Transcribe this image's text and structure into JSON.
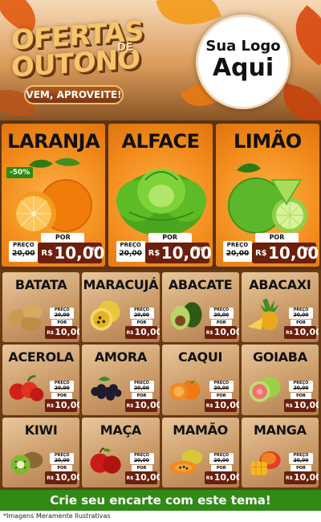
{
  "header": {
    "title_line1": "OFERTAS",
    "title_de": "DE",
    "title_line2": "OUTONO",
    "slogan": "VEM, APROVEITE!",
    "logo_line1": "Sua Logo",
    "logo_line2": "Aqui"
  },
  "featured": [
    {
      "name": "LARANJA",
      "discount": "-50%",
      "por_label": "POR",
      "old_label": "PREÇO",
      "old_price": "20,00",
      "currency": "R$",
      "price": "10,00",
      "unit": "KG",
      "image": "orange-image"
    },
    {
      "name": "ALFACE",
      "por_label": "POR",
      "old_label": "PREÇO",
      "old_price": "20,00",
      "currency": "R$",
      "price": "10,00",
      "unit": "UNID",
      "image": "lettuce-image"
    },
    {
      "name": "LIMÃO",
      "por_label": "POR",
      "old_label": "PREÇO",
      "old_price": "20,00",
      "currency": "R$",
      "price": "10,00",
      "unit": "KG",
      "image": "lime-image"
    }
  ],
  "products": [
    {
      "name": "BATATA",
      "old_label": "PREÇO",
      "old_price": "20,00",
      "por_label": "POR",
      "currency": "R$",
      "price": "10,00",
      "image": "potato-image"
    },
    {
      "name": "MARACUJÁ",
      "old_label": "PREÇO",
      "old_price": "20,00",
      "por_label": "POR",
      "currency": "R$",
      "price": "10,00",
      "image": "passionfruit-image"
    },
    {
      "name": "ABACATE",
      "old_label": "PREÇO",
      "old_price": "20,00",
      "por_label": "POR",
      "currency": "R$",
      "price": "10,00",
      "image": "avocado-image"
    },
    {
      "name": "ABACAXI",
      "old_label": "PREÇO",
      "old_price": "20,00",
      "por_label": "POR",
      "currency": "R$",
      "price": "10,00",
      "image": "pineapple-image"
    },
    {
      "name": "ACEROLA",
      "old_label": "PREÇO",
      "old_price": "20,00",
      "por_label": "POR",
      "currency": "R$",
      "price": "10,00",
      "image": "acerola-image"
    },
    {
      "name": "AMORA",
      "old_label": "PREÇO",
      "old_price": "20,00",
      "por_label": "POR",
      "currency": "R$",
      "price": "10,00",
      "image": "blackberry-image"
    },
    {
      "name": "CAQUI",
      "old_label": "PREÇO",
      "old_price": "20,00",
      "por_label": "POR",
      "currency": "R$",
      "price": "10,00",
      "image": "persimmon-image"
    },
    {
      "name": "GOIABA",
      "old_label": "PREÇO",
      "old_price": "20,00",
      "por_label": "POR",
      "currency": "R$",
      "price": "10,00",
      "image": "guava-image"
    },
    {
      "name": "KIWI",
      "old_label": "PREÇO",
      "old_price": "20,00",
      "por_label": "POR",
      "currency": "R$",
      "price": "10,00",
      "image": "kiwi-image"
    },
    {
      "name": "MAÇA",
      "old_label": "PREÇO",
      "old_price": "20,00",
      "por_label": "POR",
      "currency": "R$",
      "price": "10,00",
      "image": "apple-image"
    },
    {
      "name": "MAMÃO",
      "old_label": "PREÇO",
      "old_price": "20,00",
      "por_label": "POR",
      "currency": "R$",
      "price": "10,00",
      "image": "papaya-image"
    },
    {
      "name": "MANGA",
      "old_label": "PREÇO",
      "old_price": "20,00",
      "por_label": "POR",
      "currency": "R$",
      "price": "10,00",
      "image": "mango-image"
    }
  ],
  "footer": {
    "cta": "Crie seu encarte com este tema!",
    "disclaimer": "*Imagens Meramente Ilustrativas"
  },
  "colors": {
    "featured_bg": "#f28c1c",
    "price_tag": "#6b1f0c",
    "cta_green": "#2f8a16",
    "wood": "#c99866"
  }
}
